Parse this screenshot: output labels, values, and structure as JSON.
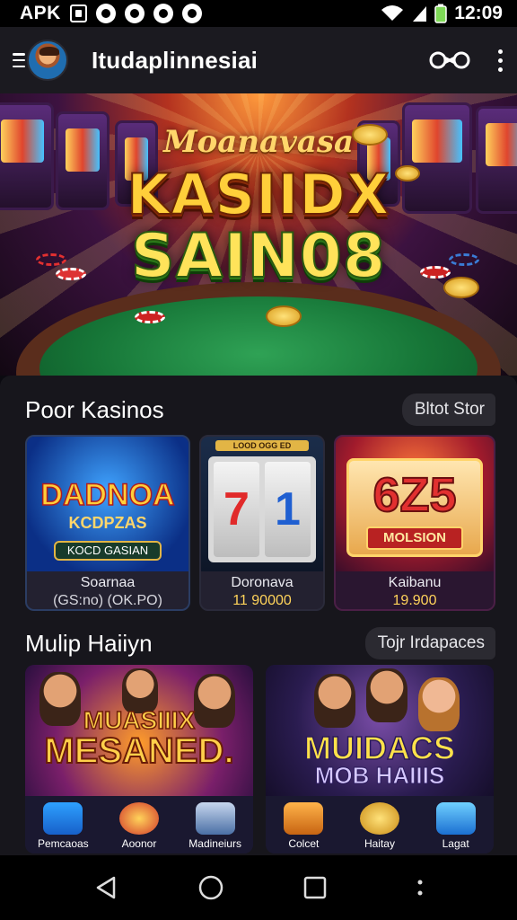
{
  "status_bar": {
    "left_text": "APK",
    "time": "12:09",
    "icons": [
      "notification-icon",
      "circle-icon",
      "circle-icon",
      "circle-icon",
      "circle-icon"
    ]
  },
  "app_bar": {
    "title": "Itudaplinnesiai",
    "actions": [
      "link-icon",
      "more-vert-icon"
    ]
  },
  "hero": {
    "subtitle": "Moanavasa",
    "title_line1": "KASIIDX",
    "title_line2": "SAIN08"
  },
  "section1": {
    "title": "Poor Kasinos",
    "action": "Bltot Stor",
    "cards": [
      {
        "art_title": "DADNOA",
        "art_sub": "KCDPZAS",
        "art_plate": "KOCD GASIAN",
        "name": "Soarnaa",
        "sub": "(GS:no) (OK.PO)"
      },
      {
        "art_strip": "LOOD OGG ED",
        "reel1": "7",
        "reel2": "1",
        "name": "Doronava",
        "sub": "11 90000"
      },
      {
        "art_digits": "6Z5",
        "art_plate": "MOLSION",
        "name": "Kaibanu",
        "sub": "19.900"
      }
    ]
  },
  "section2": {
    "title": "Mulip Haiiyn",
    "action": "Tojr Irdapaces",
    "promos": [
      {
        "line1": "MUASIIIX",
        "line2": "MESANED.",
        "tiles": [
          "Pemcaoas",
          "Aoonor",
          "Madineiurs"
        ]
      },
      {
        "line1": "MUIDACS",
        "line2": "MOB HAIIIS",
        "tiles": [
          "Colcet",
          "Haitay",
          "Lagat"
        ]
      }
    ]
  },
  "nav_bar": {
    "buttons": [
      "back-icon",
      "home-icon",
      "recents-icon",
      "more-dot-icon"
    ]
  },
  "colors": {
    "accent_gold": "#ffd35a",
    "panel_bg": "#17161c",
    "appbar_bg": "#1b1a20"
  }
}
